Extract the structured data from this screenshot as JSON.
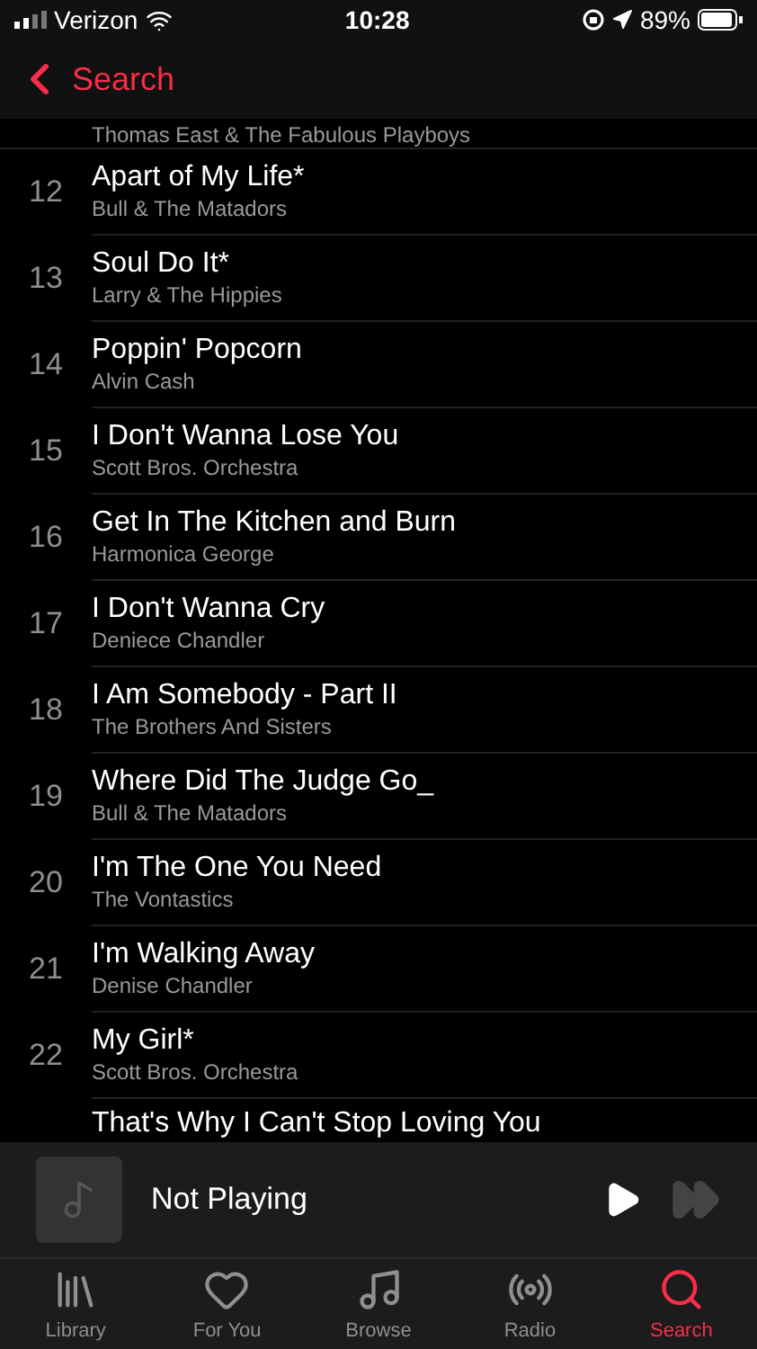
{
  "status_bar": {
    "carrier": "Verizon",
    "time": "10:28",
    "battery": "89%"
  },
  "nav": {
    "back": "Search"
  },
  "tracks": [
    {
      "artist": "Thomas East & The Fabulous Playboys"
    },
    {
      "number": "12",
      "title": "Apart of My Life*",
      "artist": "Bull & The Matadors"
    },
    {
      "number": "13",
      "title": "Soul Do It*",
      "artist": "Larry & The Hippies"
    },
    {
      "number": "14",
      "title": "Poppin' Popcorn",
      "artist": "Alvin Cash"
    },
    {
      "number": "15",
      "title": "I Don't Wanna Lose You",
      "artist": "Scott Bros. Orchestra"
    },
    {
      "number": "16",
      "title": "Get In The Kitchen and Burn",
      "artist": "Harmonica George"
    },
    {
      "number": "17",
      "title": "I Don't Wanna Cry",
      "artist": "Deniece Chandler"
    },
    {
      "number": "18",
      "title": "I Am Somebody - Part II",
      "artist": "The Brothers And Sisters"
    },
    {
      "number": "19",
      "title": "Where Did The Judge Go_",
      "artist": "Bull & The Matadors"
    },
    {
      "number": "20",
      "title": "I'm The One You Need",
      "artist": "The Vontastics"
    },
    {
      "number": "21",
      "title": "I'm Walking Away",
      "artist": "Denise Chandler"
    },
    {
      "number": "22",
      "title": "My Girl*",
      "artist": "Scott Bros. Orchestra"
    },
    {
      "title": "That's Why I Can't Stop Loving You"
    }
  ],
  "player": {
    "title": "Not Playing",
    "forward_disabled": true
  },
  "tabs": [
    {
      "label": "Library",
      "selected": false
    },
    {
      "label": "For You",
      "selected": false
    },
    {
      "label": "Browse",
      "selected": false
    },
    {
      "label": "Radio",
      "selected": false
    },
    {
      "label": "Search",
      "selected": true
    }
  ]
}
